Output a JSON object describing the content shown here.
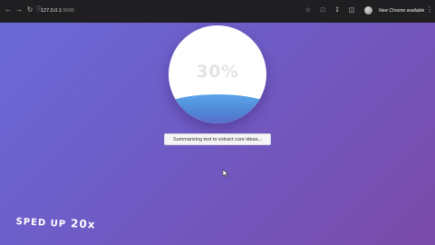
{
  "browser": {
    "url_host": "127.0.0.1",
    "url_port": ":5000",
    "update_label": "New Chrome available",
    "icons": {
      "back": "back-arrow-icon",
      "forward": "forward-arrow-icon",
      "reload": "reload-icon",
      "site_info": "site-info-icon",
      "bookmark": "star-icon",
      "extensions": "puzzle-icon",
      "downloads": "download-icon",
      "side_panel": "side-panel-icon",
      "menu": "menu-dots-icon"
    }
  },
  "progress": {
    "percent_label": "30%",
    "percent_value": 30
  },
  "status": {
    "message": "Summarizing text to extract core ideas..."
  },
  "overlay": {
    "speed_text": "SPED UP",
    "speed_multiplier": "20x"
  },
  "colors": {
    "background_start": "#6a6ad8",
    "background_end": "#7a4aa8",
    "wave": "#5aa5e8"
  }
}
